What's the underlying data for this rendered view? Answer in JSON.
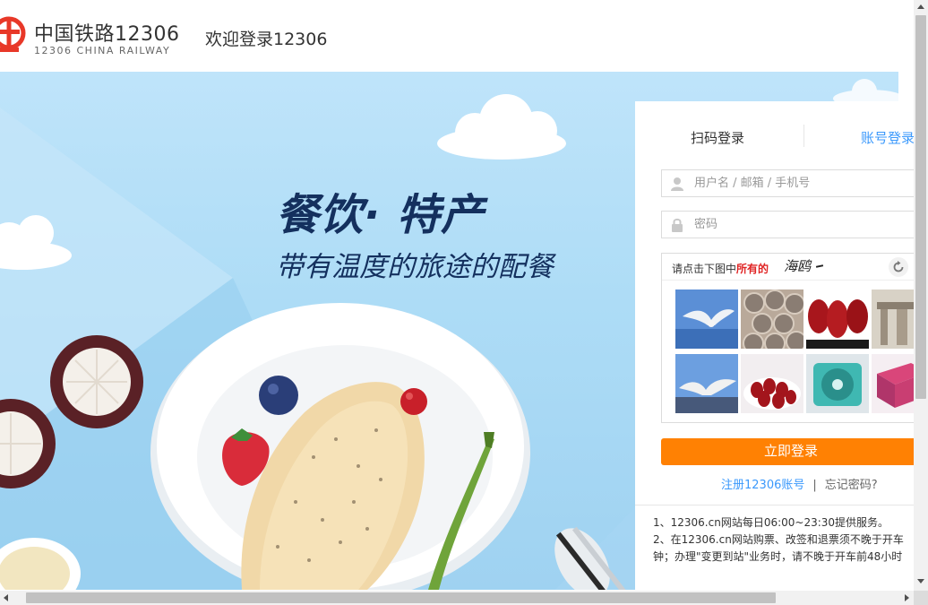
{
  "header": {
    "brand_cn": "中国铁路12306",
    "brand_en": "12306 CHINA RAILWAY",
    "welcome": "欢迎登录12306"
  },
  "banner": {
    "title": "餐饮· 特产",
    "subtitle": "带有温度的旅途的配餐"
  },
  "login": {
    "tabs": [
      {
        "label": "扫码登录",
        "active": false
      },
      {
        "label": "账号登录",
        "active": true
      }
    ],
    "username_placeholder": "用户名 / 邮箱 / 手机号",
    "username_value": "",
    "password_placeholder": "密码",
    "password_value": "",
    "captcha": {
      "prompt_prefix": "请点击下图中",
      "prompt_highlight": "所有的",
      "target": "海鸥",
      "images": [
        {
          "subject": "seagull"
        },
        {
          "subject": "lotus-seed-pod"
        },
        {
          "subject": "red-dates"
        },
        {
          "subject": "archway"
        },
        {
          "subject": "seagull"
        },
        {
          "subject": "red-dates"
        },
        {
          "subject": "ventilation-fan"
        },
        {
          "subject": "box"
        }
      ]
    },
    "submit_label": "立即登录",
    "register_link": "注册12306账号",
    "link_separator": "|",
    "forgot_link": "忘记密码?"
  },
  "notices": [
    "1、12306.cn网站每日06:00~23:30提供服务。",
    "2、在12306.cn网站购票、改签和退票须不晚于开车",
    "钟；办理\"变更到站\"业务时，请不晚于开车前48小时"
  ],
  "colors": {
    "accent_blue": "#3b99fc",
    "submit_orange": "#ff8103",
    "logo_red": "#e83828",
    "promo_navy": "#14305e",
    "banner_sky": "#addcf6"
  }
}
